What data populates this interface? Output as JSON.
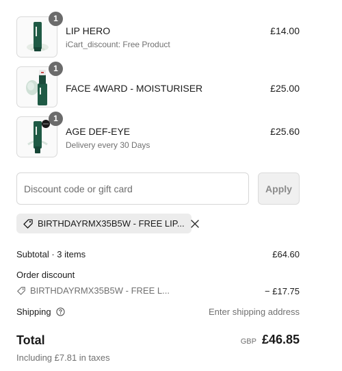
{
  "cart": {
    "items": [
      {
        "name": "LIP HERO",
        "subtitle": "iCart_discount: Free Product",
        "price": "£14.00",
        "quantity": "1",
        "image": "lip-hero-tube-product-image"
      },
      {
        "name": "FACE 4WARD - MOISTURISER",
        "subtitle": "",
        "price": "£25.00",
        "quantity": "1",
        "image": "moisturiser-pump-product-image"
      },
      {
        "name": "AGE DEF-EYE",
        "subtitle": "Delivery every 30 Days",
        "price": "£25.60",
        "quantity": "1",
        "image": "eye-cream-tube-product-image"
      }
    ]
  },
  "discount": {
    "placeholder": "Discount code or gift card",
    "value": "",
    "apply_label": "Apply",
    "applied_code": "BIRTHDAYRMX35B5W - FREE LIP...",
    "tag_icon": "tag-icon",
    "remove_icon": "close-icon"
  },
  "summary": {
    "subtotal_label": "Subtotal · 3 items",
    "subtotal_value": "£64.60",
    "order_discount_label": "Order discount",
    "discount_code_short": "BIRTHDAYRMX35B5W - FREE L...",
    "discount_value": "− £17.75",
    "shipping_label": "Shipping",
    "shipping_value": "Enter shipping address",
    "help_icon": "question-circle-icon",
    "total_label": "Total",
    "currency": "GBP",
    "total_value": "£46.85",
    "taxes_note": "Including £7.81 in taxes"
  },
  "colors": {
    "brand_green": "#1f5a45",
    "badge_gray": "#6b6b6b",
    "muted_text": "#707070"
  }
}
